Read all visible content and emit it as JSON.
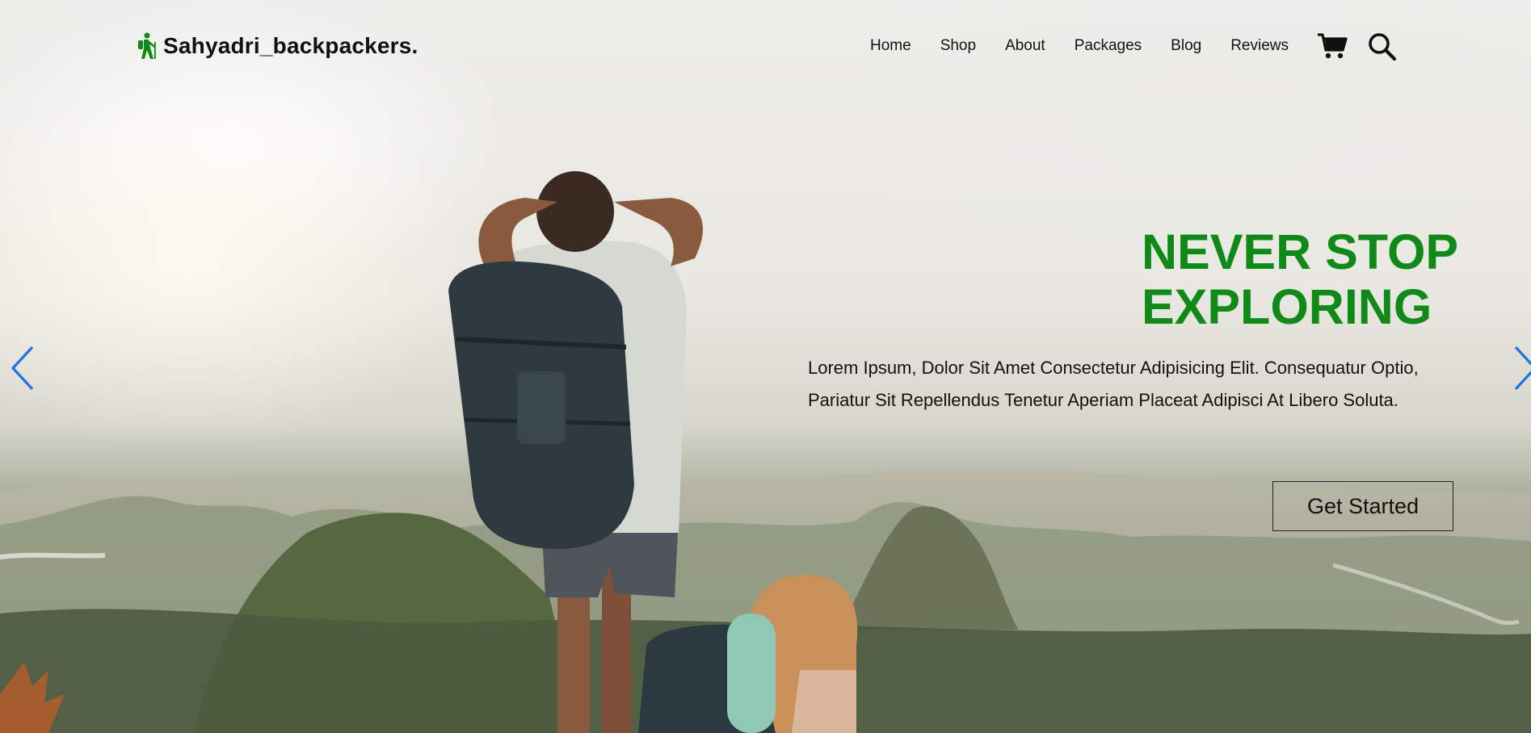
{
  "brand": {
    "name": "Sahyadri_backpackers.",
    "icon": "hiker-icon",
    "color": "#0f8a17"
  },
  "nav": {
    "items": [
      {
        "label": "Home"
      },
      {
        "label": "Shop"
      },
      {
        "label": "About"
      },
      {
        "label": "Packages"
      },
      {
        "label": "Blog"
      },
      {
        "label": "Reviews"
      }
    ],
    "cart_icon": "cart-icon",
    "search_icon": "search-icon"
  },
  "slide": {
    "headline": "NEVER STOP EXPLORING",
    "description": "Lorem Ipsum, Dolor Sit Amet Consectetur Adipisicing Elit. Consequatur Optio, Pariatur Sit Repellendus Tenetur Aperiam Placeat Adipisci At Libero Soluta.",
    "cta_label": "Get Started",
    "headline_color": "#0f8a17",
    "prev_icon": "chevron-left-icon",
    "next_icon": "chevron-right-icon",
    "arrow_color": "#1a73e8"
  }
}
